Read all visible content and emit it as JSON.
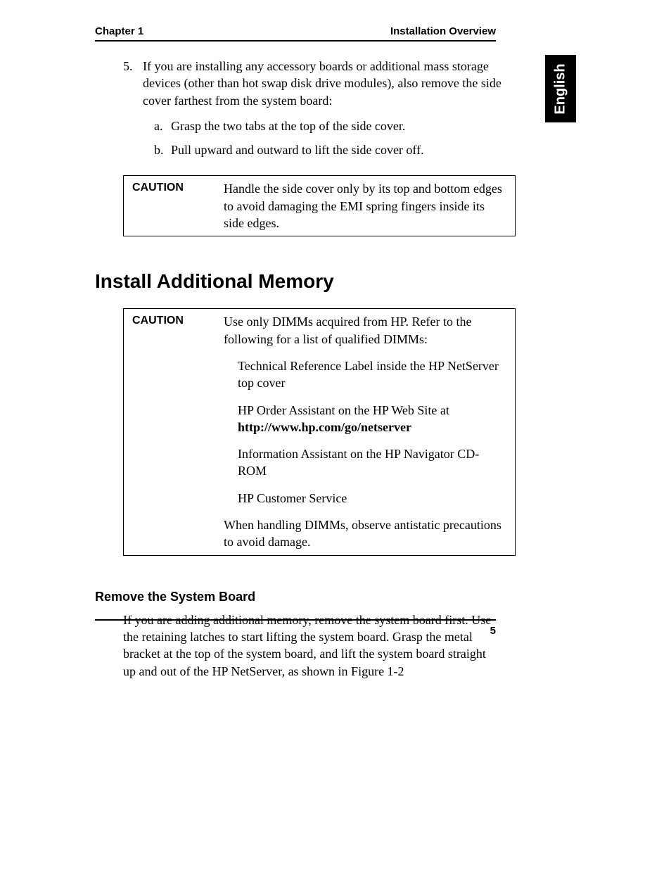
{
  "header": {
    "left": "Chapter 1",
    "right": "Installation Overview"
  },
  "langTab": "English",
  "step5": {
    "num": "5.",
    "text": "If you are installing any accessory boards or additional mass storage devices (other than hot swap disk drive modules), also remove the side cover farthest from the system board:",
    "a": {
      "letter": "a.",
      "text": "Grasp the two tabs at the top of the side cover."
    },
    "b": {
      "letter": "b.",
      "text": "Pull upward and outward to lift the side cover off."
    }
  },
  "caution1": {
    "label": "CAUTION",
    "text": "Handle the side cover only by its top and bottom edges to avoid damaging the EMI spring fingers inside its side edges."
  },
  "h1": "Install Additional Memory",
  "caution2": {
    "label": "CAUTION",
    "p1": "Use only DIMMs acquired from HP. Refer to the following for a list of qualified DIMMs:",
    "p2": "Technical Reference Label inside the HP NetServer top cover",
    "p3a": "HP Order Assistant on the HP Web Site at ",
    "p3b": "http://www.hp.com/go/netserver",
    "p4": "Information Assistant on the HP Navigator CD-ROM",
    "p5": "HP Customer Service",
    "p6": "When handling DIMMs, observe antistatic precautions to avoid damage."
  },
  "h2": "Remove the System Board",
  "bodyP": "If you are adding additional memory, remove the system board first. Use the retaining latches to start lifting the system board. Grasp the metal bracket at the top of the system board, and lift the system board straight up and out of the HP NetServer, as shown in Figure 1-2",
  "pageNum": "5"
}
